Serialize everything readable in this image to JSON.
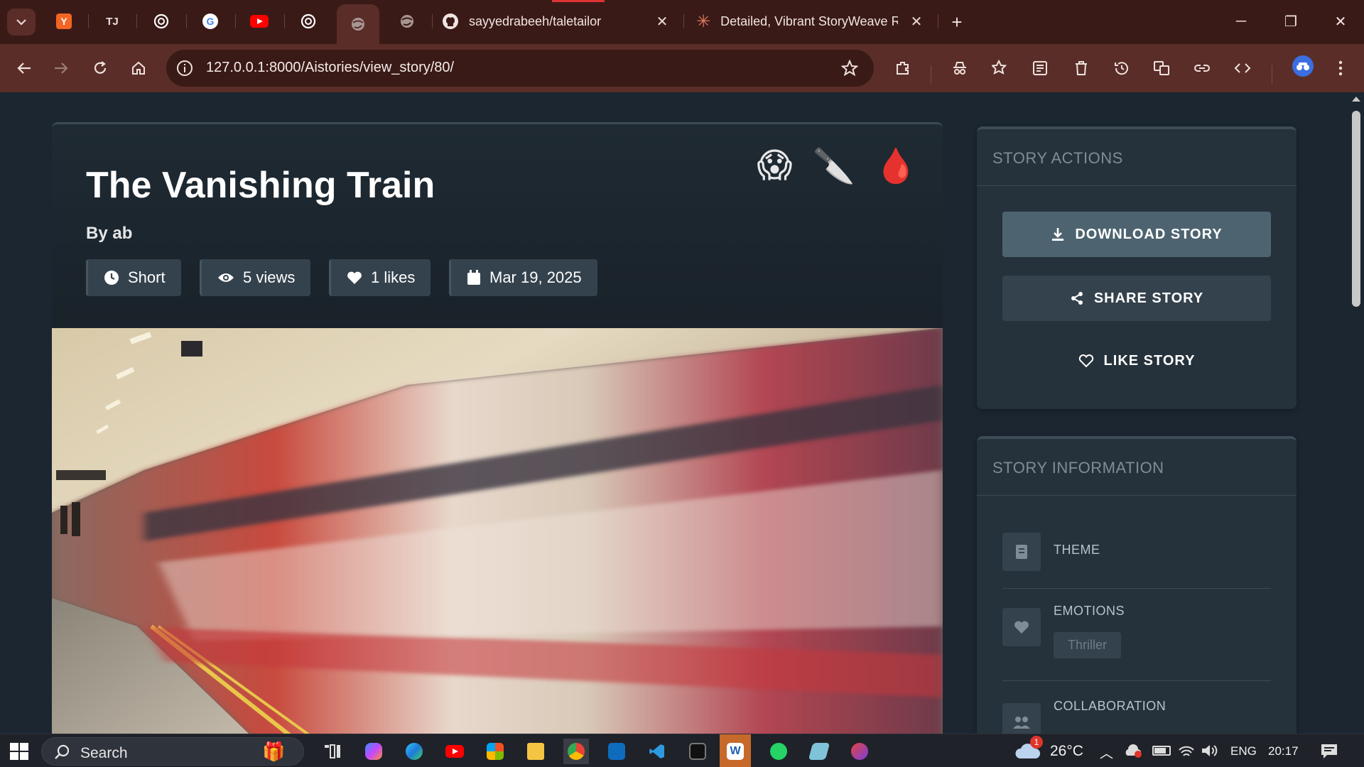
{
  "browser": {
    "tabs": [
      {
        "title": "sayyedrabeeh/taletailor",
        "icon": "github-icon"
      },
      {
        "title": "Detailed, Vibrant StoryWeave R",
        "icon": "claude-icon"
      }
    ],
    "pinned_tabs": [
      "y-combinator-icon",
      "tj-icon",
      "chatgpt-icon",
      "google-icon",
      "youtube-icon",
      "chatgpt-icon",
      "globe-icon",
      "globe-icon"
    ],
    "url": "127.0.0.1:8000/Aistories/view_story/80/"
  },
  "story": {
    "title": "The Vanishing Train",
    "author": "By ab",
    "emojis": [
      "😱",
      "🔪",
      "🩸"
    ],
    "meta": {
      "length": "Short",
      "views": "5 views",
      "likes": "1 likes",
      "date": "Mar 19, 2025"
    }
  },
  "actions": {
    "heading": "STORY ACTIONS",
    "download": "DOWNLOAD STORY",
    "share": "SHARE STORY",
    "like": "LIKE STORY"
  },
  "info": {
    "heading": "STORY INFORMATION",
    "theme_label": "THEME",
    "emotions_label": "EMOTIONS",
    "emotion_tag": "Thriller",
    "collaboration_label": "COLLABORATION"
  },
  "taskbar": {
    "search_placeholder": "Search",
    "temperature": "26°C",
    "notification_count": "1",
    "language": "ENG",
    "time": "20:17"
  },
  "colors": {
    "browser_frame": "#3a1a17",
    "toolbar": "#5a2d28",
    "page_bg": "#1b2631",
    "panel_bg": "#25323b",
    "download_button": "#4d6470",
    "share_button": "#34424d"
  }
}
